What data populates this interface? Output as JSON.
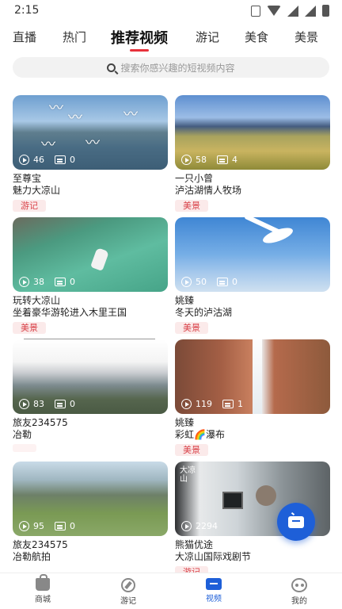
{
  "status_bar": {
    "time": "2:15"
  },
  "tabs": [
    {
      "label": "直播"
    },
    {
      "label": "热门"
    },
    {
      "label": "推荐视频",
      "active": true
    },
    {
      "label": "游记"
    },
    {
      "label": "美食"
    },
    {
      "label": "美景"
    }
  ],
  "search": {
    "placeholder": "搜索你感兴趣的短视频内容"
  },
  "cards": [
    {
      "views": "46",
      "comments": "0",
      "author": "至尊宝",
      "title": "魅力大凉山",
      "tag": "游记"
    },
    {
      "views": "58",
      "comments": "4",
      "author": "一只小曾",
      "title": "泸沽湖情人牧场",
      "tag": "美景"
    },
    {
      "views": "38",
      "comments": "0",
      "author": "玩转大凉山",
      "title": "坐着豪华游轮进入木里王国",
      "tag": "美景"
    },
    {
      "views": "50",
      "comments": "0",
      "author": "姚臻",
      "title": "冬天的泸沽湖",
      "tag": "美景"
    },
    {
      "views": "83",
      "comments": "0",
      "author": "旅友234575",
      "title": "冶勒",
      "tag": ""
    },
    {
      "views": "119",
      "comments": "1",
      "author": "姚臻",
      "title": "彩虹🌈瀑布",
      "tag": "美景"
    },
    {
      "views": "95",
      "comments": "0",
      "author": "旅友234575",
      "title": "冶勒航拍",
      "tag": ""
    },
    {
      "views": "2294",
      "comments": "",
      "author": "熊猫优途",
      "title": "大凉山国际戏剧节",
      "tag": "游记",
      "stamp": "大凉山"
    }
  ],
  "bottom_nav": [
    {
      "label": "商城",
      "icon": "bag-icon"
    },
    {
      "label": "游记",
      "icon": "compass-icon"
    },
    {
      "label": "视频",
      "icon": "tv-icon",
      "active": true
    },
    {
      "label": "我的",
      "icon": "panda-icon"
    }
  ],
  "colors": {
    "accent": "#1e5fd8",
    "tab_indicator": "#e8323c",
    "tag_text": "#d9434a",
    "tag_bg": "#fbeaea"
  }
}
